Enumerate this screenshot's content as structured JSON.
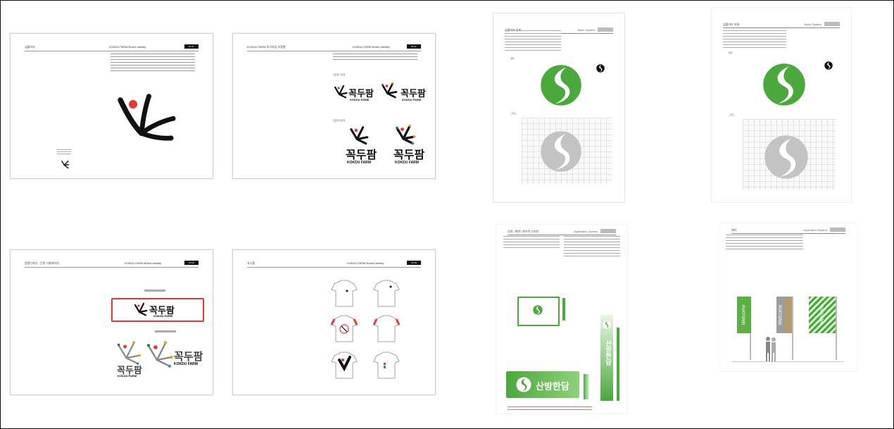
{
  "kokdu": {
    "brand_header": "KOKDU FARM Brand Identity",
    "pages": [
      {
        "title": "심볼마크",
        "tag": "BI-01"
      },
      {
        "title": "KOKDU FARM 로고타입 조합형",
        "tag": "BI-02"
      },
      {
        "title": "응용디자인 - 간판 시뮬레이션",
        "tag": "AP-01"
      },
      {
        "title": "유니폼",
        "tag": "AP-02"
      }
    ],
    "wordmark": "꼭두팜",
    "wordmark_en": "KOKDU FARM",
    "label_horizontal": "조합형 가로형",
    "label_vertical": "조합형 세로형"
  },
  "sanbang": {
    "symbol_title": "심볼마크 상세",
    "basic_system": "Basic System",
    "label_color": "컬러",
    "label_grid": "그리드",
    "app_sign_title": "간판 / 현판 / 현수막 디자인",
    "app_banner_title": "배너",
    "application_system": "Application System",
    "sign_text": "산방한담",
    "banner_text": "Welcome",
    "palette": {
      "green": "#4aa83c",
      "gray": "#c3c3c3",
      "tan": "#b49a6e",
      "red": "#e53935",
      "orange": "#f39c12",
      "blue": "#2e86de"
    }
  }
}
